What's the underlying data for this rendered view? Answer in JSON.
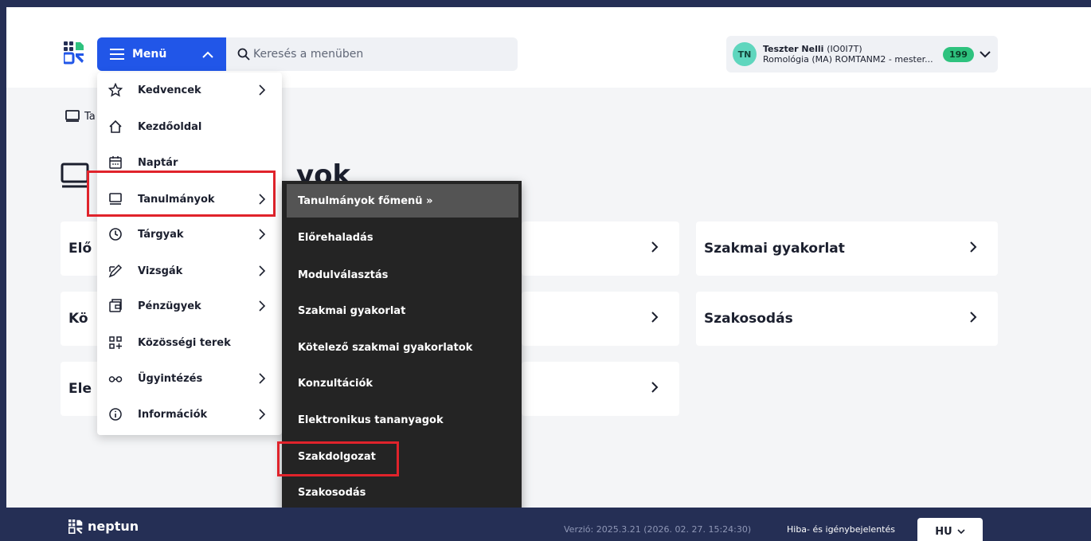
{
  "header": {
    "menu_label": "Menü",
    "search_placeholder": "Keresés a menüben",
    "user": {
      "initials": "TN",
      "name": "Teszter Nelli",
      "code": "(IO0I7T)",
      "program": "Romológia (MA) ROMTANM2 - mester...",
      "notifications": "199"
    }
  },
  "page": {
    "breadcrumb": "Ta",
    "title": "yok",
    "cards": [
      {
        "label": "Elő"
      },
      {
        "label": ""
      },
      {
        "label": "Szakmai gyakorlat"
      },
      {
        "label": "Kö"
      },
      {
        "label": ""
      },
      {
        "label": "Szakosodás"
      },
      {
        "label": "Ele"
      },
      {
        "label": ""
      }
    ]
  },
  "menu": {
    "items": [
      {
        "label": "Kedvencek",
        "icon": "star-icon",
        "has_sub": true
      },
      {
        "label": "Kezdőoldal",
        "icon": "home-icon",
        "has_sub": false
      },
      {
        "label": "Naptár",
        "icon": "calendar-icon",
        "has_sub": false
      },
      {
        "label": "Tanulmányok",
        "icon": "book-icon",
        "has_sub": true
      },
      {
        "label": "Tárgyak",
        "icon": "clock-icon",
        "has_sub": true
      },
      {
        "label": "Vizsgák",
        "icon": "pen-icon",
        "has_sub": true
      },
      {
        "label": "Pénzügyek",
        "icon": "wallet-icon",
        "has_sub": true
      },
      {
        "label": "Közösségi terek",
        "icon": "grid-icon",
        "has_sub": false
      },
      {
        "label": "Ügyintézés",
        "icon": "glasses-icon",
        "has_sub": true
      },
      {
        "label": "Információk",
        "icon": "info-icon",
        "has_sub": true
      }
    ]
  },
  "submenu": {
    "header": "Tanulmányok főmenü »",
    "items": [
      "Előrehaladás",
      "Modulválasztás",
      "Szakmai gyakorlat",
      "Kötelező szakmai gyakorlatok",
      "Konzultációk",
      "Elektronikus tananyagok",
      "Szakdolgozat",
      "Szakosodás"
    ]
  },
  "footer": {
    "brand": "neptun",
    "version": "Verzió: 2025.3.21 (2026. 02. 27. 15:24:30)",
    "report": "Hiba- és igénybejelentés",
    "language": "HU"
  },
  "colors": {
    "primary": "#2156e8",
    "navy": "#252f55",
    "highlight": "#e0232b",
    "badge": "#2ec27e"
  }
}
